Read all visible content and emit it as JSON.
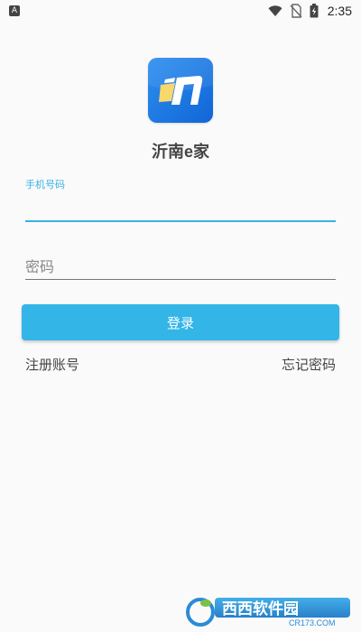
{
  "status_bar": {
    "notification_icon": "A",
    "time": "2:35",
    "icons": [
      "wifi-icon",
      "no-signal-icon",
      "battery-charging-icon"
    ]
  },
  "app": {
    "name": "沂南e家",
    "logo_icon": "app-logo-icon",
    "brand_color": "#1e7be6"
  },
  "form": {
    "phone_label": "手机号码",
    "phone_value": "",
    "password_placeholder": "密码",
    "password_value": "",
    "accent_color": "#3ab0e2"
  },
  "actions": {
    "login_label": "登录",
    "login_color": "#33b5e8",
    "register_label": "注册账号",
    "forgot_label": "忘记密码"
  },
  "watermark": {
    "text": "西西软件园",
    "subtext": "CR173.COM"
  }
}
